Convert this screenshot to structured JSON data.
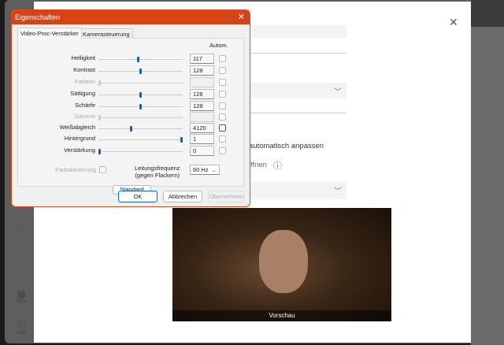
{
  "background": {
    "sidebar": {
      "more": "...",
      "apps": "Apps",
      "help": "Hilfe"
    },
    "modal": {
      "auto_adjust": "automatisch anpassen",
      "open_link": "ffnen",
      "preview_label": "Vorschau"
    }
  },
  "dialog": {
    "title": "Eigenschaften",
    "tabs": [
      "Video-Proc-Verstärker",
      "Kamerasteuerung"
    ],
    "auto_header": "Autom.",
    "rows": [
      {
        "label": "Helligkeit",
        "value": "117",
        "level": 0.47,
        "enabled": true
      },
      {
        "label": "Kontrast",
        "value": "128",
        "level": 0.5,
        "enabled": true
      },
      {
        "label": "Farbton",
        "value": "",
        "level": 0,
        "enabled": false
      },
      {
        "label": "Sättigung",
        "value": "128",
        "level": 0.5,
        "enabled": true
      },
      {
        "label": "Schärfe",
        "value": "128",
        "level": 0.5,
        "enabled": true
      },
      {
        "label": "Gamma",
        "value": "",
        "level": 0,
        "enabled": false
      },
      {
        "label": "Weißabgleich",
        "value": "4120",
        "level": 0.38,
        "enabled": true
      },
      {
        "label": "Hintergrund",
        "value": "1",
        "level": 1,
        "enabled": true
      },
      {
        "label": "Verstärkung",
        "value": "0",
        "level": 0,
        "enabled": true
      }
    ],
    "color_enable": "Farbaktivierung",
    "powerline_label1": "Leitungsfrequenz",
    "powerline_label2": "(gegen Flackern)",
    "powerline_value": "60 Hz",
    "standard": "Standard",
    "ok": "OK",
    "cancel": "Abbrechen",
    "apply": "Übernehmen"
  },
  "colors": {
    "titlebar": "#d84315",
    "accent": "#0a64c8"
  }
}
